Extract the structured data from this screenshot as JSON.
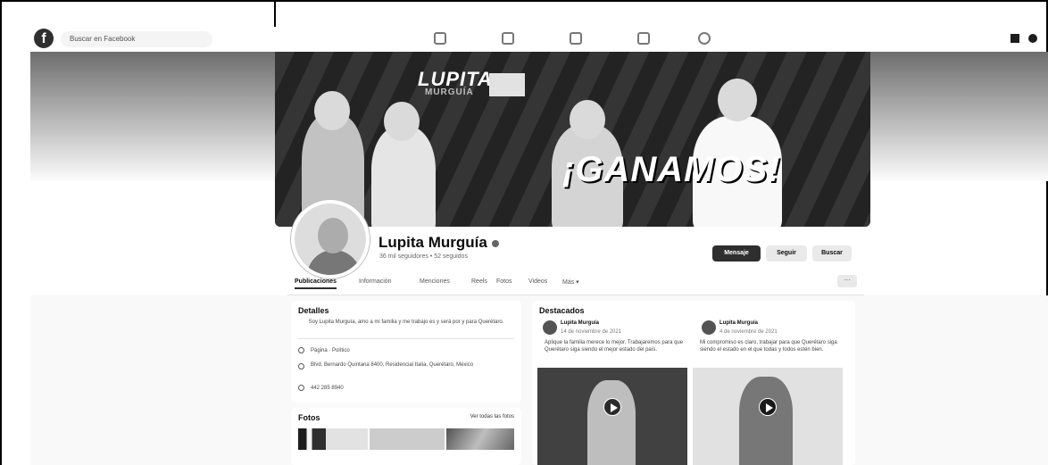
{
  "topbar": {
    "search_placeholder": "Buscar en Facebook"
  },
  "cover": {
    "brand": "LUPITA",
    "brand_sub": "MURGUÍA",
    "slogan": "¡GANAMOS!"
  },
  "profile": {
    "name": "Lupita Murguía",
    "subtitle": "36 mil seguidores • 52 seguidos"
  },
  "actions": {
    "message": "Mensaje",
    "follow": "Seguir",
    "search": "Buscar"
  },
  "tabs": [
    {
      "label": "Publicaciones"
    },
    {
      "label": "Información"
    },
    {
      "label": "Menciones"
    },
    {
      "label": "Reels"
    },
    {
      "label": "Fotos"
    },
    {
      "label": "Videos"
    },
    {
      "label": "Más ▾"
    }
  ],
  "tab_more": "···",
  "details": {
    "title": "Detalles",
    "bio": "Soy Lupita Murguía, amo a mi familia y me trabajo es y será por y para Querétaro.",
    "page_type": "Página · Político",
    "address": "Blvd. Bernardo Quintana 8400, Residencial Italia, Querétaro, México",
    "phone": "442 285 8940"
  },
  "photos": {
    "title": "Fotos",
    "see_all": "Ver todas las fotos"
  },
  "featured": {
    "title": "Destacados",
    "posts": [
      {
        "author": "Lupita Murguía",
        "date": "14 de noviembre de 2021",
        "text": "Aplique la familia merece lo mejor. Trabajaremos para que Querétaro siga siendo el mejor estado del país."
      },
      {
        "author": "Lupita Murguía",
        "date": "4 de noviembre de 2021",
        "text": "Mi compromiso es claro, trabajar para que Querétaro siga siendo el estado en el que todas y todos estén bien."
      }
    ]
  }
}
